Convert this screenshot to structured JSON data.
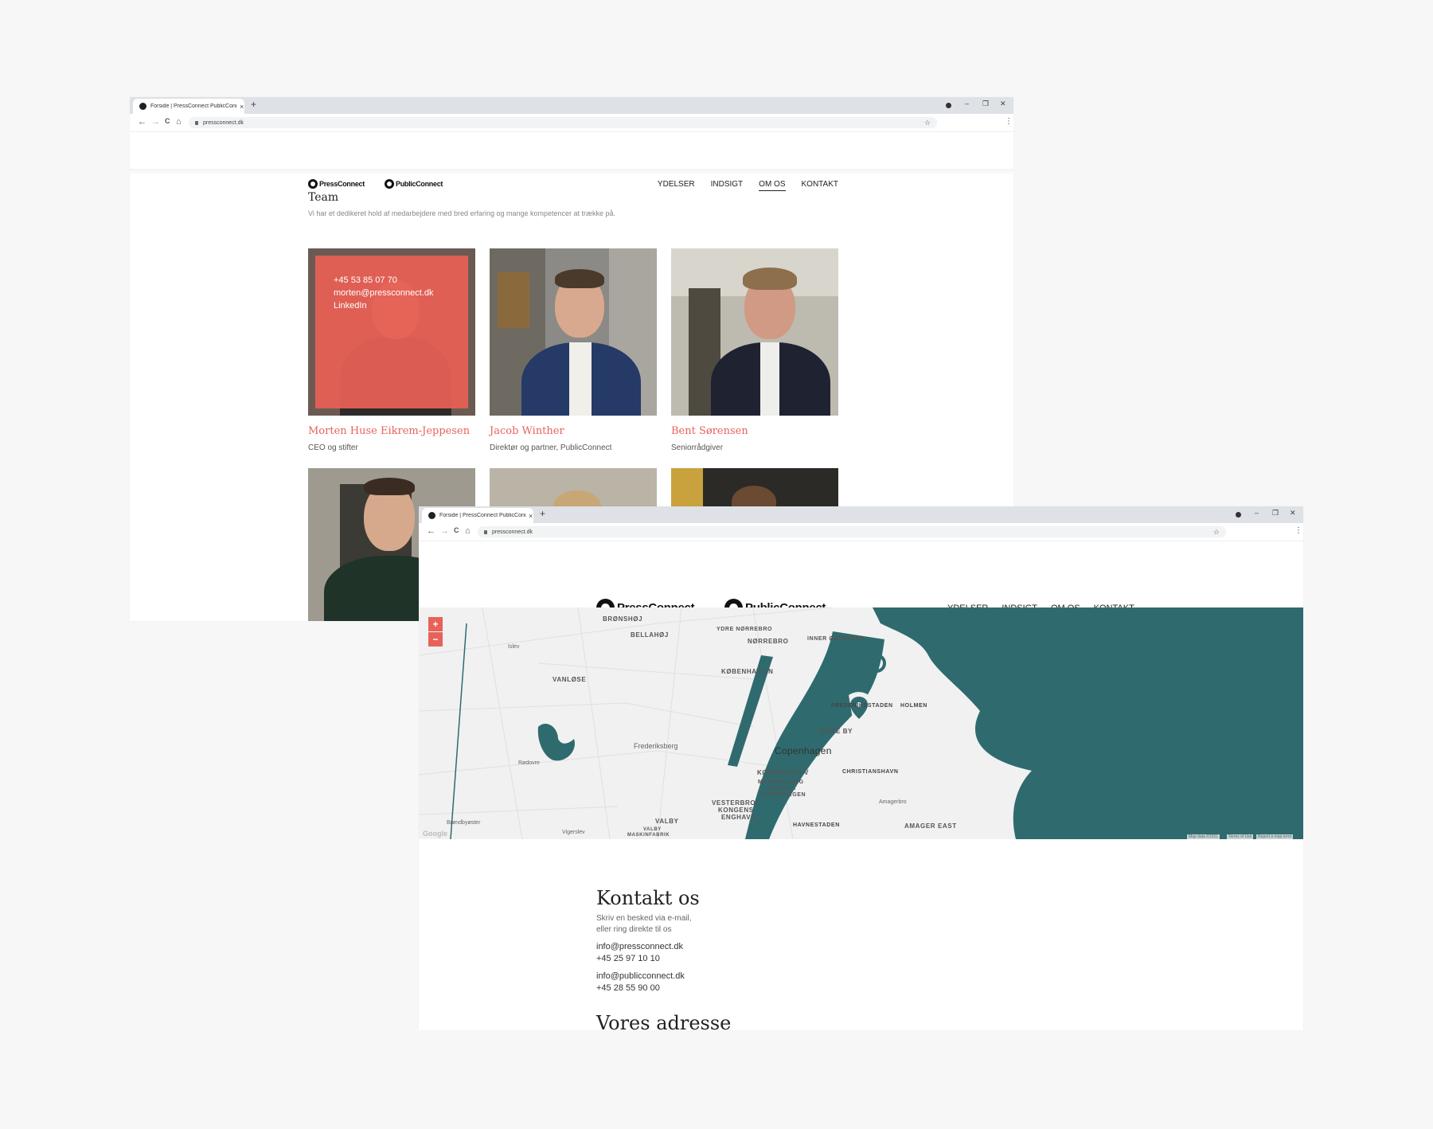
{
  "browser": {
    "tab_title": "Forside | PressConnect PublicConnect",
    "new_tab": "+",
    "close_tab": "×",
    "url": "pressconnect.dk",
    "nav_back": "←",
    "nav_forward": "→",
    "nav_reload": "C",
    "nav_home": "⌂",
    "star": "☆",
    "menu": "⋮",
    "minimize": "–",
    "restore": "❐",
    "close": "✕"
  },
  "logos": {
    "press": "PressConnect",
    "public": "PublicConnect"
  },
  "nav": {
    "items": [
      "YDELSER",
      "INDSIGT",
      "OM OS",
      "KONTAKT"
    ]
  },
  "team": {
    "title": "Team",
    "subtitle": "Vi har et dedikeret hold af medarbejdere med bred erfaring og mange kompetencer at trække på.",
    "members": [
      {
        "name": "Morten Huse Eikrem-Jeppesen",
        "role": "CEO og stifter",
        "phone": "+45 53 85 07 70",
        "email": "morten@pressconnect.dk",
        "linkedin": "LinkedIn"
      },
      {
        "name": "Jacob Winther",
        "role": "Direktør og partner, PublicConnect"
      },
      {
        "name": "Bent Sørensen",
        "role": "Seniorrådgiver"
      }
    ]
  },
  "map": {
    "zoom_in": "+",
    "zoom_out": "−",
    "labels": {
      "bronshoj": "BRØNSHØJ",
      "bellahoj": "BELLAHØJ",
      "ydre_norrebro": "YDRE NØRREBRO",
      "norrebro": "NØRREBRO",
      "inner_osterbro": "INNER ØSTERBRO",
      "islev": "Islev",
      "vanlose": "VANLØSE",
      "kobenhavn_n": "KØBENHAVN N",
      "frederiksstaden": "FREDERIKSSTADEN",
      "holmen": "HOLMEN",
      "indre_by": "INDRE BY",
      "frederiksberg": "Frederiksberg",
      "copenhagen": "Copenhagen",
      "rodovre": "Rødovre",
      "kobenhavn_v": "KØBENHAVN V",
      "christianshavn": "CHRISTIANSHAVN",
      "meatpacking1": "MEATPACKING",
      "meatpacking2": "DISTRICT",
      "meatpacking3": "COPENHAGEN",
      "vesterbro1": "VESTERBRO/",
      "vesterbro2": "KONGENS",
      "vesterbro3": "ENGHAVE",
      "amagerbro": "Amagerbro",
      "brondbyoster": "Brøndbyøster",
      "valby": "VALBY",
      "valby_mask1": "VALBY",
      "valby_mask2": "MASKINFABRIK",
      "vigerslev": "Vigerslev",
      "havnestaden": "HAVNESTADEN",
      "amager_east": "AMAGER EAST",
      "google": "Google"
    },
    "attribution": [
      "Map data ©2021",
      "Terms of Use",
      "Report a map error"
    ]
  },
  "contact": {
    "title": "Kontakt os",
    "intro_1": "Skriv en besked via e-mail,",
    "intro_2": "eller ring direkte til os",
    "press_email": "info@pressconnect.dk",
    "press_phone": "+45 25 97 10 10",
    "public_email": "info@publicconnect.dk",
    "public_phone": "+45 28 55 90 00",
    "address_title": "Vores adresse"
  },
  "colors": {
    "accent": "#e8625a",
    "water": "#2f6b6e",
    "map_land": "#f1f1f1"
  }
}
